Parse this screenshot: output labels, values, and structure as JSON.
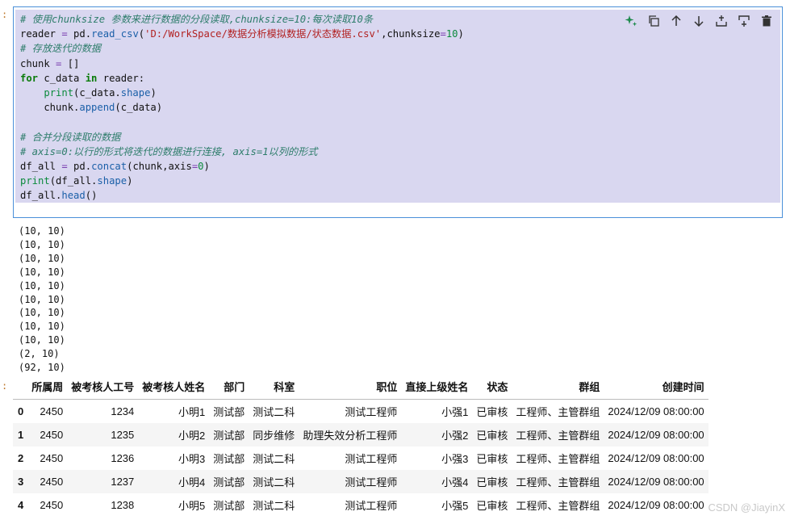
{
  "cell": {
    "input_marker": ":",
    "output_marker": ":",
    "code": [
      "# 使用chunksize 参数来进行数据的分段读取,chunksize=10:每次读取10条",
      "reader = pd.read_csv('D:/WorkSpace/数据分析模拟数据/状态数据.csv',chunksize=10)",
      "# 存放迭代的数据",
      "chunk = []",
      "for c_data in reader:",
      "    print(c_data.shape)",
      "    chunk.append(c_data)",
      "",
      "# 合并分段读取的数据",
      "# axis=0:以行的形式将迭代的数据进行连接, axis=1以列的形式",
      "df_all = pd.concat(chunk,axis=0)",
      "print(df_all.shape)",
      "df_all.head()"
    ]
  },
  "toolbar": {
    "buttons": [
      "sparkle-icon",
      "copy-icon",
      "move-up-icon",
      "move-down-icon",
      "insert-above-icon",
      "insert-below-icon",
      "delete-icon"
    ]
  },
  "output": {
    "lines": [
      "(10, 10)",
      "(10, 10)",
      "(10, 10)",
      "(10, 10)",
      "(10, 10)",
      "(10, 10)",
      "(10, 10)",
      "(10, 10)",
      "(10, 10)",
      "(2, 10)",
      "(92, 10)"
    ]
  },
  "dataframe": {
    "columns": [
      "",
      "所属周",
      "被考核人工号",
      "被考核人姓名",
      "部门",
      "科室",
      "职位",
      "直接上级姓名",
      "状态",
      "群组",
      "创建时间"
    ],
    "rows": [
      [
        "0",
        "2450",
        "1234",
        "小明1",
        "测试部",
        "测试二科",
        "测试工程师",
        "小强1",
        "已审核",
        "工程师、主管群组",
        "2024/12/09 08:00:00"
      ],
      [
        "1",
        "2450",
        "1235",
        "小明2",
        "测试部",
        "同步维修",
        "助理失效分析工程师",
        "小强2",
        "已审核",
        "工程师、主管群组",
        "2024/12/09 08:00:00"
      ],
      [
        "2",
        "2450",
        "1236",
        "小明3",
        "测试部",
        "测试二科",
        "测试工程师",
        "小强3",
        "已审核",
        "工程师、主管群组",
        "2024/12/09 08:00:00"
      ],
      [
        "3",
        "2450",
        "1237",
        "小明4",
        "测试部",
        "测试二科",
        "测试工程师",
        "小强4",
        "已审核",
        "工程师、主管群组",
        "2024/12/09 08:00:00"
      ],
      [
        "4",
        "2450",
        "1238",
        "小明5",
        "测试部",
        "测试二科",
        "测试工程师",
        "小强5",
        "已审核",
        "工程师、主管群组",
        "2024/12/09 08:00:00"
      ]
    ]
  },
  "watermark": "CSDN @JiayinX"
}
